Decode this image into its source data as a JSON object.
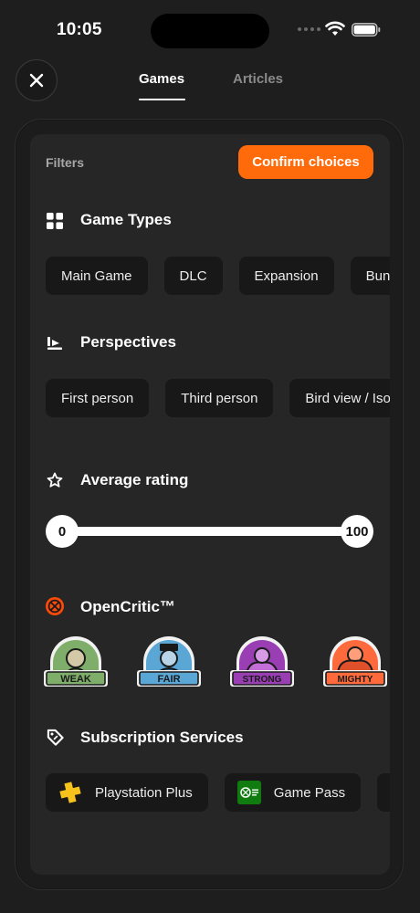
{
  "status_bar": {
    "time": "10:05"
  },
  "header": {
    "tabs": [
      {
        "label": "Games",
        "active": true
      },
      {
        "label": "Articles",
        "active": false
      }
    ]
  },
  "filters": {
    "label": "Filters",
    "confirm_label": "Confirm choices",
    "accent_color": "#ff6b0a"
  },
  "game_types": {
    "title": "Game Types",
    "icon": "grid-icon",
    "chips": [
      "Main Game",
      "DLC",
      "Expansion",
      "Bund"
    ]
  },
  "perspectives": {
    "title": "Perspectives",
    "icon": "perspective-icon",
    "chips": [
      "First person",
      "Third person",
      "Bird view / Iso"
    ]
  },
  "average_rating": {
    "title": "Average rating",
    "icon": "star-icon",
    "min": "0",
    "max": "100"
  },
  "opencritic": {
    "title": "OpenCritic™",
    "icon": "opencritic-icon",
    "badges": [
      {
        "label": "WEAK",
        "color": "#7fae6b"
      },
      {
        "label": "FAIR",
        "color": "#5aa7d6"
      },
      {
        "label": "STRONG",
        "color": "#9a3fb3"
      },
      {
        "label": "MIGHTY",
        "color": "#ff6a3d"
      }
    ]
  },
  "subscriptions": {
    "title": "Subscription Services",
    "icon": "tag-icon",
    "items": [
      {
        "label": "Playstation Plus",
        "icon": "ps-plus-icon"
      },
      {
        "label": "Game Pass",
        "icon": "game-pass-icon"
      }
    ]
  }
}
